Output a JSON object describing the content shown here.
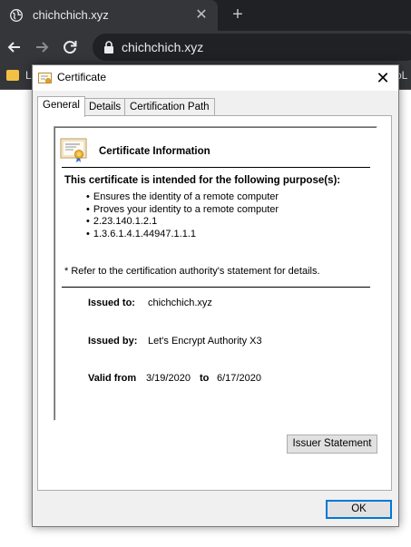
{
  "browser": {
    "tab_title": "chichchich.xyz",
    "url": "chichchich.xyz",
    "bookmark_left": "L",
    "bookmark_right": "oL"
  },
  "dialog": {
    "title": "Certificate",
    "tabs": [
      "General",
      "Details",
      "Certification Path"
    ],
    "heading": "Certificate Information",
    "purpose_heading": "This certificate is intended for the following purpose(s):",
    "purposes": [
      "Ensures the identity of a remote computer",
      "Proves your identity to a remote computer",
      "2.23.140.1.2.1",
      "1.3.6.1.4.1.44947.1.1.1"
    ],
    "note": "* Refer to the certification authority's statement for details.",
    "issued_to_label": "Issued to:",
    "issued_to": "chichchich.xyz",
    "issued_by_label": "Issued by:",
    "issued_by": "Let's Encrypt Authority X3",
    "valid_from_label": "Valid from",
    "valid_from": "3/19/2020",
    "to_label": "to",
    "valid_to": "6/17/2020",
    "issuer_statement_button": "Issuer Statement",
    "ok_button": "OK"
  },
  "colors": {
    "chrome_dark": "#202124",
    "chrome_toolbar": "#35363a",
    "dialog_bg": "#f0f0f0",
    "focus_blue": "#0078d7"
  },
  "icons": {
    "favicon": "globe-icon",
    "back": "arrow-left-icon",
    "forward": "arrow-right-icon",
    "reload": "reload-icon",
    "lock": "lock-icon",
    "certificate": "certificate-icon"
  }
}
